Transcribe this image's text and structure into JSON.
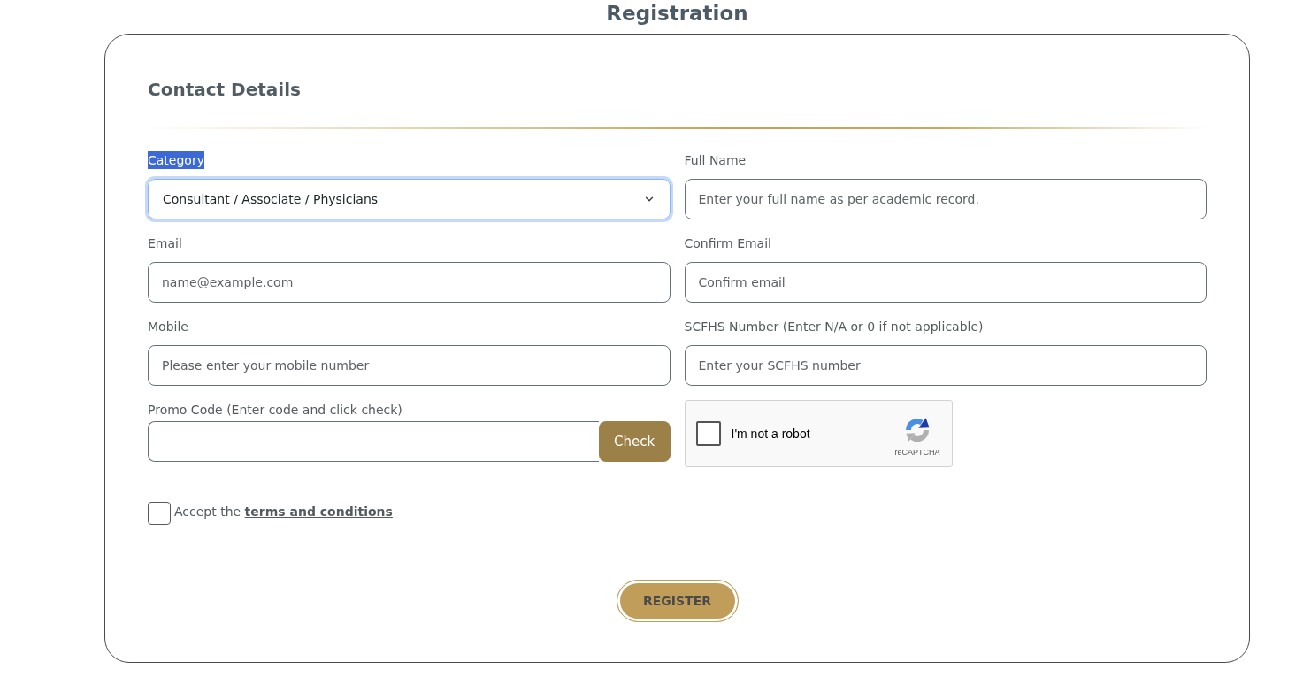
{
  "page_title": "Registration",
  "section": {
    "title": "Contact Details"
  },
  "fields": [
    {
      "kind": "select",
      "label": "Category",
      "label_highlighted": true,
      "value": "Consultant / Associate / Physicians",
      "focused": true
    },
    {
      "kind": "text",
      "label": "Full Name",
      "label_highlighted": false,
      "placeholder": "Enter your full name as per academic record.",
      "focused": false
    },
    {
      "kind": "text",
      "label": "Email",
      "label_highlighted": false,
      "placeholder": "name@example.com",
      "focused": false
    },
    {
      "kind": "text",
      "label": "Confirm Email",
      "label_highlighted": false,
      "placeholder": "Confirm email",
      "focused": false
    },
    {
      "kind": "text",
      "label": "Mobile",
      "label_highlighted": false,
      "placeholder": "Please enter your mobile number",
      "focused": false
    },
    {
      "kind": "text",
      "label": "SCFHS Number (Enter N/A or 0 if not applicable)",
      "label_highlighted": false,
      "placeholder": "Enter your SCFHS number",
      "focused": false
    },
    {
      "kind": "promo",
      "label": "Promo Code (Enter code and click check)",
      "label_highlighted": false,
      "button": "Check",
      "focused": false
    },
    {
      "kind": "captcha",
      "checked": false,
      "text": "I'm not a robot",
      "brand": "reCAPTCHA"
    }
  ],
  "terms": {
    "checked": false,
    "text": "Accept the",
    "link": "terms and conditions"
  },
  "submit": "REGISTER"
}
